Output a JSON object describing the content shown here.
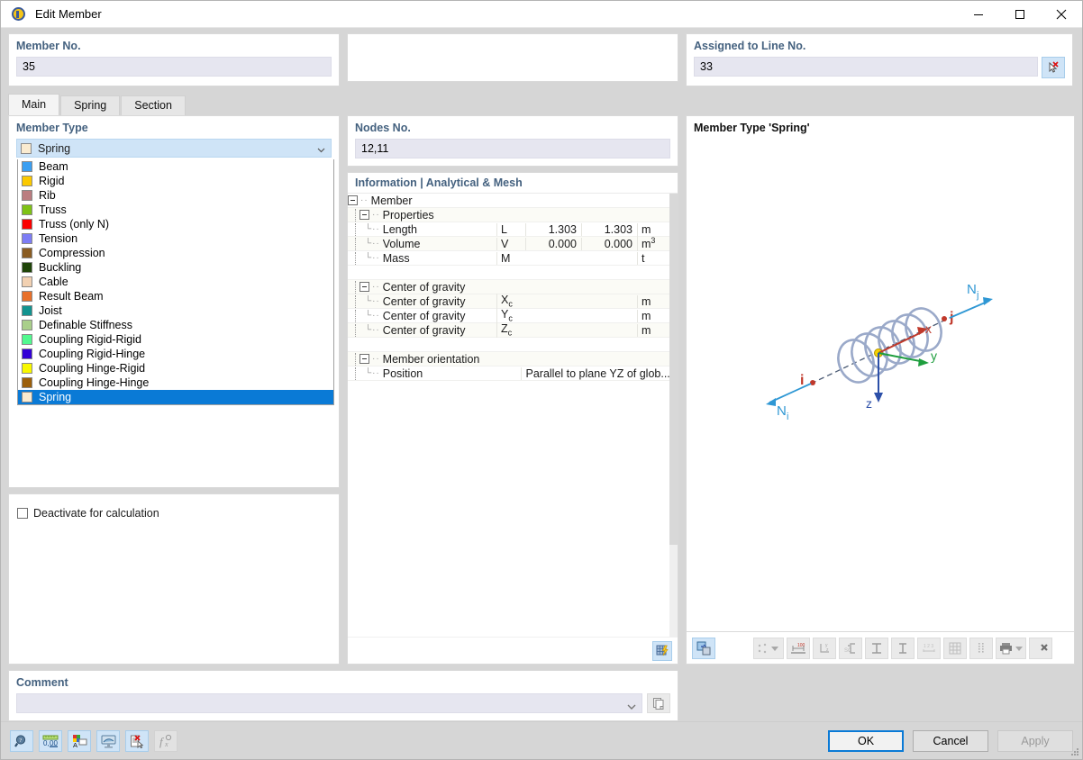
{
  "window": {
    "title": "Edit Member",
    "icon": "member-icon",
    "minimize": "minimize-icon",
    "maximize": "maximize-icon",
    "close": "close-icon"
  },
  "top": {
    "member_no_label": "Member No.",
    "member_no_value": "35",
    "assigned_line_label": "Assigned to Line No.",
    "assigned_line_value": "33",
    "pick_line_icon": "pick-line-icon"
  },
  "tabs": [
    {
      "label": "Main",
      "active": true
    },
    {
      "label": "Spring",
      "active": false
    },
    {
      "label": "Section",
      "active": false
    }
  ],
  "member_type": {
    "group_label": "Member Type",
    "selected": "Spring",
    "selected_color": "#faebd0",
    "deactivate_label": "Deactivate for calculation",
    "deactivate_checked": false,
    "options": [
      {
        "label": "Beam",
        "color": "#3b9ff2"
      },
      {
        "label": "Rigid",
        "color": "#fbc900"
      },
      {
        "label": "Rib",
        "color": "#bb7d80"
      },
      {
        "label": "Truss",
        "color": "#7ec216"
      },
      {
        "label": "Truss (only N)",
        "color": "#fb0000"
      },
      {
        "label": "Tension",
        "color": "#7d7df5"
      },
      {
        "label": "Compression",
        "color": "#8a5c22"
      },
      {
        "label": "Buckling",
        "color": "#1f4509"
      },
      {
        "label": "Cable",
        "color": "#f2d1b2"
      },
      {
        "label": "Result Beam",
        "color": "#e8702a"
      },
      {
        "label": "Joist",
        "color": "#12938f"
      },
      {
        "label": "Definable Stiffness",
        "color": "#a9cf8a"
      },
      {
        "label": "Coupling Rigid-Rigid",
        "color": "#52f98f"
      },
      {
        "label": "Coupling Rigid-Hinge",
        "color": "#3300d6"
      },
      {
        "label": "Coupling Hinge-Rigid",
        "color": "#f8f800"
      },
      {
        "label": "Coupling Hinge-Hinge",
        "color": "#9c5f0a"
      },
      {
        "label": "Spring",
        "color": "#faebd0",
        "selected": true
      }
    ]
  },
  "nodes": {
    "group_label": "Nodes No.",
    "value": "12,11"
  },
  "information": {
    "header": "Information | Analytical & Mesh",
    "grid_icon": "table-lightning-icon",
    "tree": [
      {
        "type": "group",
        "indent": 0,
        "label": "Member"
      },
      {
        "type": "group",
        "indent": 1,
        "label": "Properties"
      },
      {
        "type": "row",
        "indent": 2,
        "label": "Length",
        "symbol": "L",
        "v1": "1.303",
        "v2": "1.303",
        "unit": "m"
      },
      {
        "type": "row",
        "indent": 2,
        "label": "Volume",
        "symbol": "V",
        "v1": "0.000",
        "v2": "0.000",
        "unit": "m3"
      },
      {
        "type": "row",
        "indent": 2,
        "label": "Mass",
        "symbol": "M",
        "v1": "",
        "v2": "",
        "unit": "t"
      },
      {
        "type": "spacer"
      },
      {
        "type": "group",
        "indent": 1,
        "label": "Center of gravity"
      },
      {
        "type": "row",
        "indent": 2,
        "label": "Center of gravity",
        "symbol": "Xc",
        "v1": "",
        "v2": "",
        "unit": "m"
      },
      {
        "type": "row",
        "indent": 2,
        "label": "Center of gravity",
        "symbol": "Yc",
        "v1": "",
        "v2": "",
        "unit": "m"
      },
      {
        "type": "row",
        "indent": 2,
        "label": "Center of gravity",
        "symbol": "Zc",
        "v1": "",
        "v2": "",
        "unit": "m"
      },
      {
        "type": "spacer"
      },
      {
        "type": "group",
        "indent": 1,
        "label": "Member orientation"
      },
      {
        "type": "wide",
        "indent": 2,
        "label": "Position",
        "symbol": "",
        "value": "Parallel to plane YZ of glob..."
      }
    ]
  },
  "preview": {
    "title": "Member Type 'Spring'",
    "labels": {
      "node_i": "i",
      "node_j": "j",
      "force_i": "N",
      "force_i_sub": "i",
      "force_j": "N",
      "force_j_sub": "j",
      "axis_x": "x",
      "axis_y": "y",
      "axis_z": "z"
    },
    "colors": {
      "spring": "#9aa9c9",
      "axis_x": "#c0392b",
      "axis_y": "#1e9e3e",
      "axis_z": "#2c4fa8",
      "force": "#2e97d4",
      "node": "#2f4f6f"
    }
  },
  "preview_toolbar": [
    {
      "name": "render-mode-button",
      "icon": "render-mode-icon",
      "active": true
    },
    {
      "name": "points-dropdown-button",
      "icon": "points-icon",
      "has_arrow": true
    },
    {
      "name": "dimensions-button",
      "icon": "dimension-100-icon"
    },
    {
      "name": "local-axes-button",
      "icon": "local-axes-icon"
    },
    {
      "name": "shear-center-button",
      "icon": "shear-center-icon"
    },
    {
      "name": "section-horizontal-button",
      "icon": "i-section-horizontal-icon"
    },
    {
      "name": "section-vertical-button",
      "icon": "i-section-vertical-icon"
    },
    {
      "name": "numbering-button",
      "icon": "numbering-123-icon"
    },
    {
      "name": "grid-button",
      "icon": "grid-icon"
    },
    {
      "name": "mesh-button",
      "icon": "mesh-dots-icon"
    },
    {
      "name": "print-button",
      "icon": "printer-icon",
      "has_arrow": true
    },
    {
      "name": "settings-button",
      "icon": "wrench-icon"
    }
  ],
  "comment": {
    "group_label": "Comment",
    "value": "",
    "dropdown_icon": "chevron-down-icon",
    "copy_icon": "copy-icon"
  },
  "footer": {
    "icons": [
      {
        "name": "search-button",
        "icon": "magnifier-icon"
      },
      {
        "name": "units-button",
        "icon": "units-000-icon"
      },
      {
        "name": "display-properties-button",
        "icon": "display-properties-icon"
      },
      {
        "name": "view-button",
        "icon": "view-monitor-icon"
      },
      {
        "name": "delete-entry-button",
        "icon": "delete-document-icon"
      },
      {
        "name": "formula-button",
        "icon": "function-icon",
        "disabled": true
      }
    ],
    "ok": "OK",
    "cancel": "Cancel",
    "apply": "Apply",
    "apply_disabled": true
  }
}
